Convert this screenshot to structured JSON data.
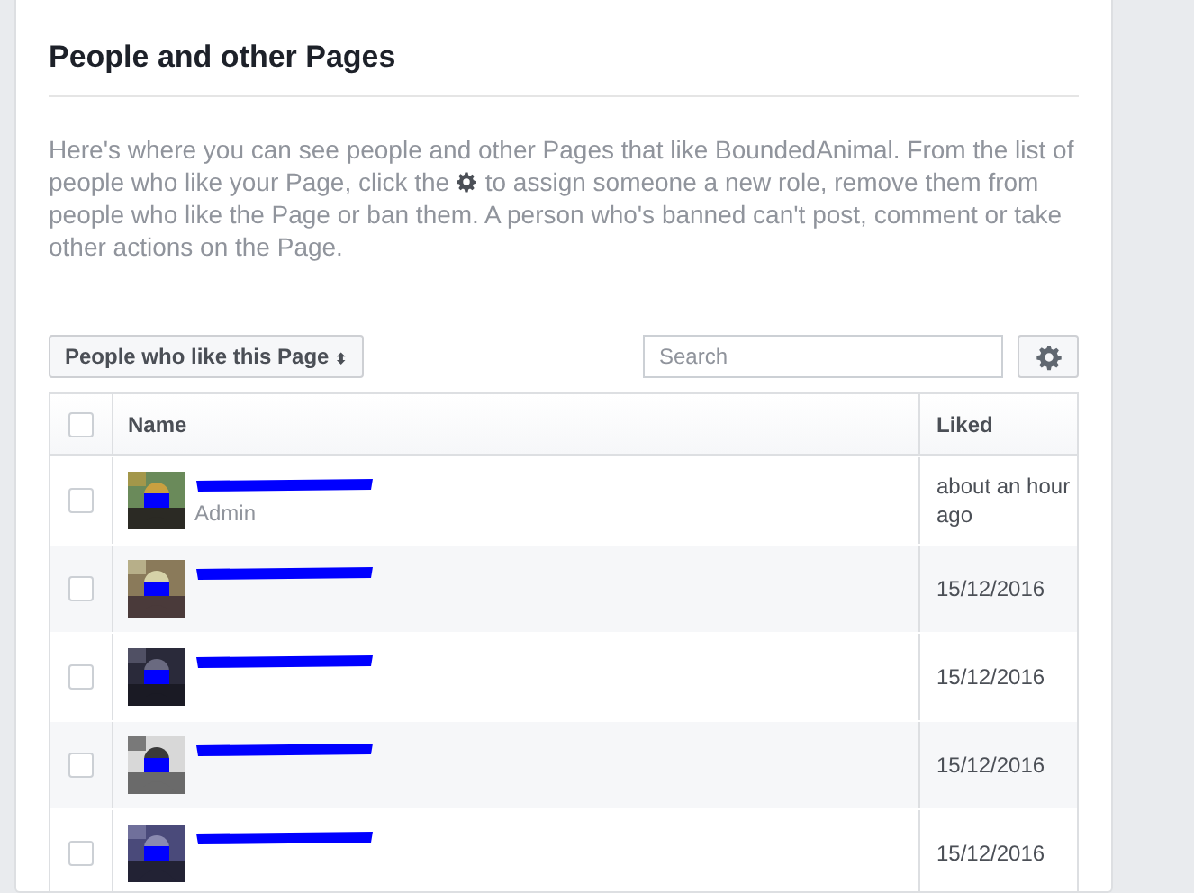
{
  "title": "People and other Pages",
  "description": {
    "before_icon": "Here's where you can see people and other Pages that like BoundedAnimal. From the list of people who like your Page, click the",
    "after_icon": "to assign someone a new role, remove them from people who like the Page or ban them. A person who's banned can't post, comment or take other actions on the Page."
  },
  "filter": {
    "label": "People who like this Page",
    "caret": "⬍"
  },
  "search": {
    "placeholder": "Search"
  },
  "table": {
    "select_all": {
      "checked": false
    },
    "columns": [
      "Name",
      "Liked"
    ],
    "rows": [
      {
        "checked": false,
        "role": "Admin",
        "liked": "about an hour ago"
      },
      {
        "checked": false,
        "liked": "15/12/2016"
      },
      {
        "checked": false,
        "liked": "15/12/2016"
      },
      {
        "checked": false,
        "liked": "15/12/2016"
      },
      {
        "checked": false,
        "liked": "15/12/2016"
      }
    ]
  }
}
